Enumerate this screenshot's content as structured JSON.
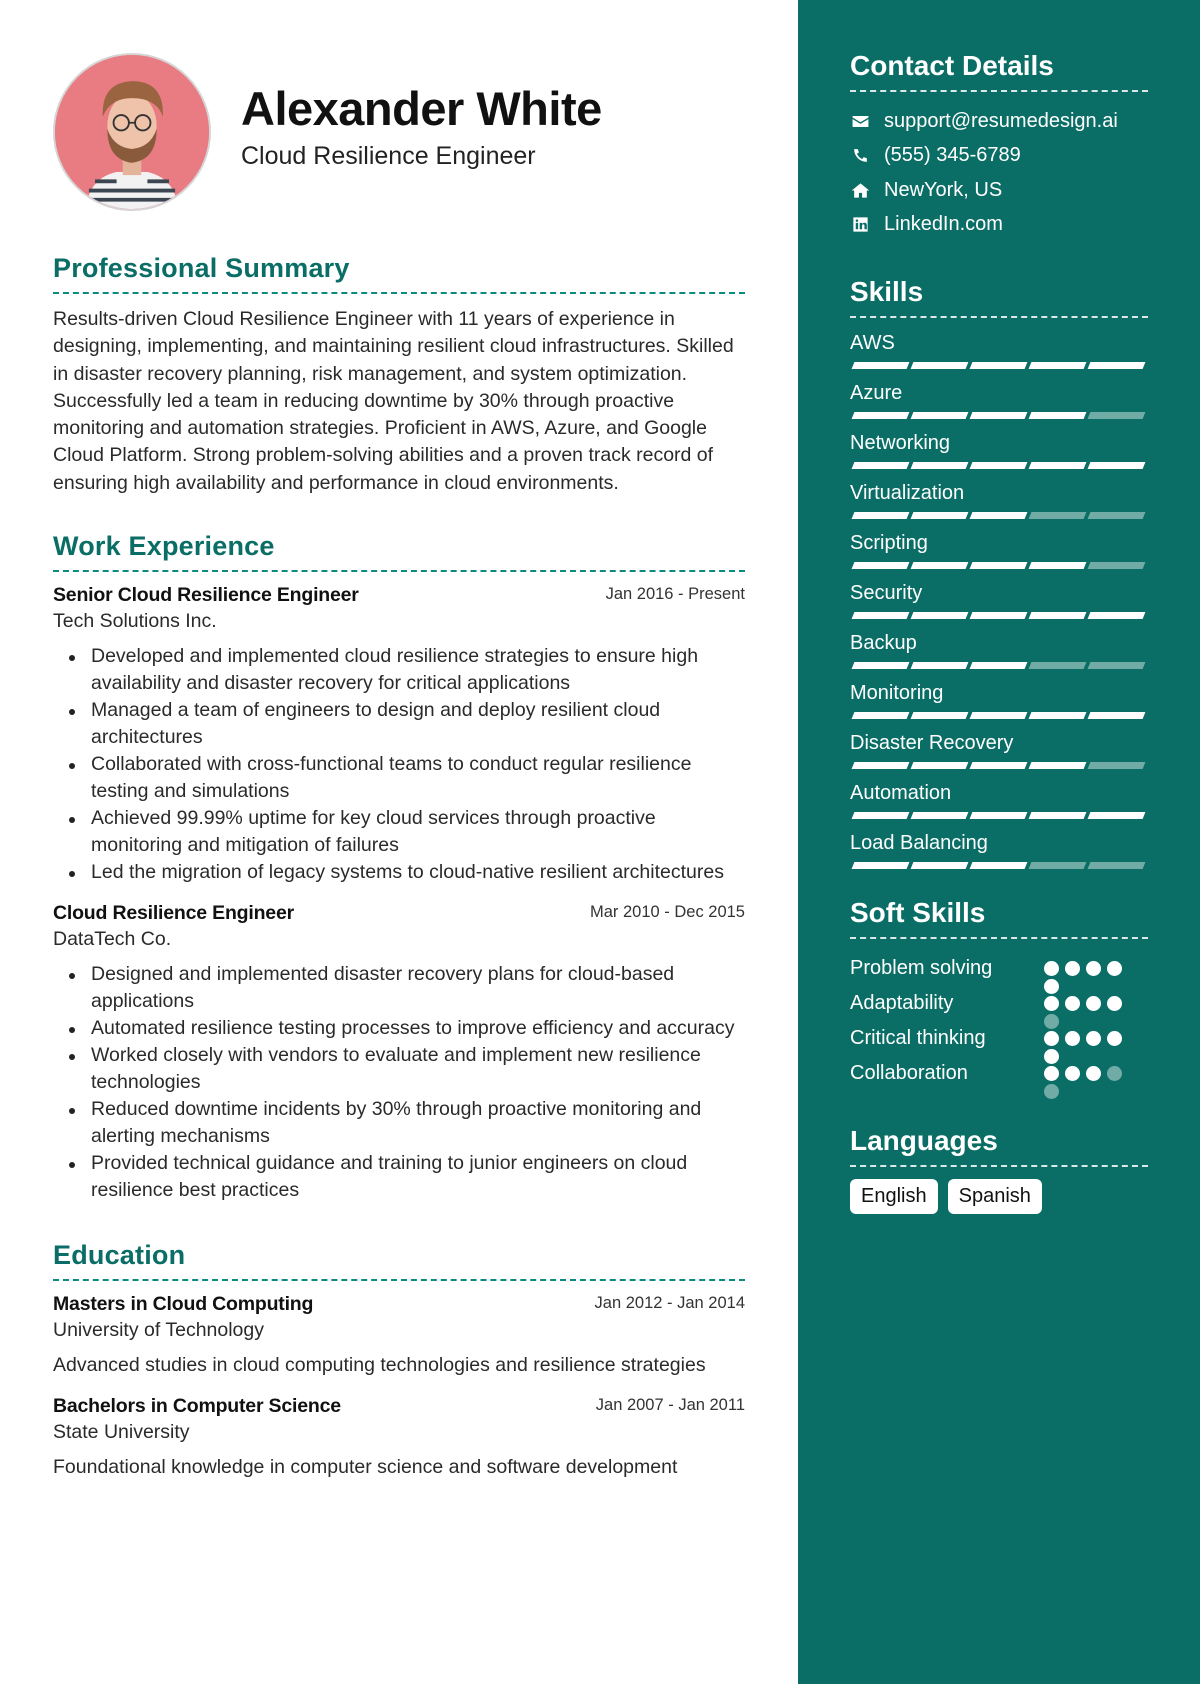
{
  "profile": {
    "name": "Alexander White",
    "title": "Cloud Resilience Engineer"
  },
  "summary": {
    "heading": "Professional Summary",
    "text": "Results-driven Cloud Resilience Engineer with 11 years of experience in designing, implementing, and maintaining resilient cloud infrastructures. Skilled in disaster recovery planning, risk management, and system optimization. Successfully led a team in reducing downtime by 30% through proactive monitoring and automation strategies. Proficient in AWS, Azure, and Google Cloud Platform. Strong problem-solving abilities and a proven track record of ensuring high availability and performance in cloud environments."
  },
  "experience": {
    "heading": "Work Experience",
    "jobs": [
      {
        "title": "Senior Cloud Resilience Engineer",
        "company": "Tech Solutions Inc.",
        "dates": "Jan 2016 - Present",
        "bullets": [
          "Developed and implemented cloud resilience strategies to ensure high availability and disaster recovery for critical applications",
          "Managed a team of engineers to design and deploy resilient cloud architectures",
          "Collaborated with cross-functional teams to conduct regular resilience testing and simulations",
          "Achieved 99.99% uptime for key cloud services through proactive monitoring and mitigation of failures",
          "Led the migration of legacy systems to cloud-native resilient architectures"
        ]
      },
      {
        "title": "Cloud Resilience Engineer",
        "company": "DataTech Co.",
        "dates": "Mar 2010 - Dec 2015",
        "bullets": [
          "Designed and implemented disaster recovery plans for cloud-based applications",
          "Automated resilience testing processes to improve efficiency and accuracy",
          "Worked closely with vendors to evaluate and implement new resilience technologies",
          "Reduced downtime incidents by 30% through proactive monitoring and alerting mechanisms",
          "Provided technical guidance and training to junior engineers on cloud resilience best practices"
        ]
      }
    ]
  },
  "education": {
    "heading": "Education",
    "items": [
      {
        "degree": "Masters in Cloud Computing",
        "school": "University of Technology",
        "dates": "Jan 2012 - Jan 2014",
        "description": "Advanced studies in cloud computing technologies and resilience strategies"
      },
      {
        "degree": "Bachelors in Computer Science",
        "school": "State University",
        "dates": "Jan 2007 - Jan 2011",
        "description": "Foundational knowledge in computer science and software development"
      }
    ]
  },
  "contact": {
    "heading": "Contact Details",
    "items": [
      {
        "icon": "envelope-icon",
        "text": "support@resumedesign.ai"
      },
      {
        "icon": "phone-icon",
        "text": "(555) 345-6789"
      },
      {
        "icon": "home-icon",
        "text": "NewYork, US"
      },
      {
        "icon": "linkedin-icon",
        "text": "LinkedIn.com"
      }
    ]
  },
  "skills": {
    "heading": "Skills",
    "max": 5,
    "items": [
      {
        "name": "AWS",
        "level": 5
      },
      {
        "name": "Azure",
        "level": 4
      },
      {
        "name": "Networking",
        "level": 5
      },
      {
        "name": "Virtualization",
        "level": 3
      },
      {
        "name": "Scripting",
        "level": 4
      },
      {
        "name": "Security",
        "level": 5
      },
      {
        "name": "Backup",
        "level": 3
      },
      {
        "name": "Monitoring",
        "level": 5
      },
      {
        "name": "Disaster Recovery",
        "level": 4
      },
      {
        "name": "Automation",
        "level": 5
      },
      {
        "name": "Load Balancing",
        "level": 3
      }
    ]
  },
  "soft_skills": {
    "heading": "Soft Skills",
    "max": 5,
    "items": [
      {
        "name": "Problem solving",
        "level": 5
      },
      {
        "name": "Adaptability",
        "level": 4
      },
      {
        "name": "Critical thinking",
        "level": 5
      },
      {
        "name": "Collaboration",
        "level": 3
      }
    ]
  },
  "languages": {
    "heading": "Languages",
    "items": [
      "English",
      "Spanish"
    ]
  },
  "colors": {
    "accent": "#0b6e66",
    "sidebar_bg": "#0b6e66",
    "text": "#222222"
  }
}
